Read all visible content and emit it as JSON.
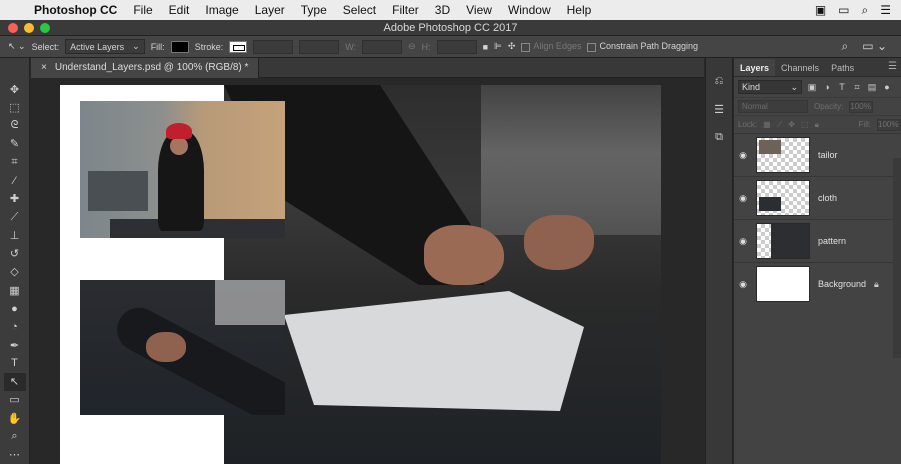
{
  "menubar": {
    "app_name": "Photoshop CC",
    "items": [
      "File",
      "Edit",
      "Image",
      "Layer",
      "Type",
      "Select",
      "Filter",
      "3D",
      "View",
      "Window",
      "Help"
    ]
  },
  "window": {
    "title": "Adobe Photoshop CC 2017"
  },
  "options": {
    "select_label": "Select:",
    "select_value": "Active Layers",
    "fill_label": "Fill:",
    "stroke_label": "Stroke:",
    "w_label": "W:",
    "h_label": "H:",
    "align_edges": "Align Edges",
    "constrain_path": "Constrain Path Dragging"
  },
  "document": {
    "tab_title": "Understand_Layers.psd @ 100% (RGB/8) *"
  },
  "layers_panel": {
    "tabs": [
      "Layers",
      "Channels",
      "Paths"
    ],
    "kind_label": "Kind",
    "blend_mode": "Normal",
    "opacity_label": "Opacity:",
    "opacity_value": "100%",
    "lock_label": "Lock:",
    "fill_label": "Fill:",
    "fill_value": "100%",
    "layers": [
      {
        "name": "tailor"
      },
      {
        "name": "cloth"
      },
      {
        "name": "pattern"
      },
      {
        "name": "Background"
      }
    ]
  },
  "colors": {
    "accent_close": "#fc5f57",
    "accent_minimize": "#fdbc2e",
    "accent_zoom": "#28c840"
  }
}
